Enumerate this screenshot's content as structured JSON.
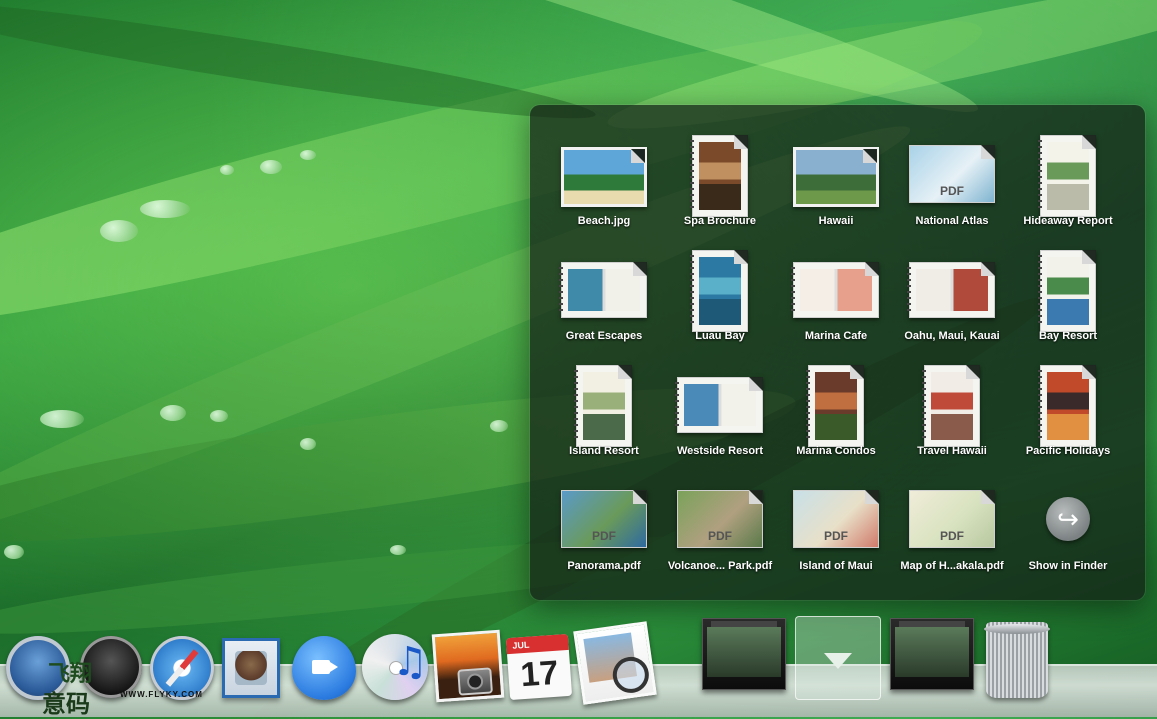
{
  "stack": {
    "items": [
      {
        "label": "Beach.jpg",
        "kind": "photo",
        "colors": [
          "#5ea6d8",
          "#2d7a3a",
          "#e8dcae"
        ]
      },
      {
        "label": "Spa Brochure",
        "kind": "brochure",
        "colors": [
          "#7a4a2a",
          "#c09060",
          "#3a2a1a"
        ]
      },
      {
        "label": "Hawaii",
        "kind": "photo",
        "colors": [
          "#8ab0d0",
          "#3d6e3a",
          "#6d9a4a"
        ]
      },
      {
        "label": "National Atlas",
        "kind": "pdf",
        "pdf_text": "PDF",
        "colors": [
          "#a9d2e8",
          "#e6f1f6",
          "#7fb4d0"
        ]
      },
      {
        "label": "Hideaway Report",
        "kind": "brochure",
        "colors": [
          "#f3f3ea",
          "#6a9a5a",
          "#bbbbaa"
        ]
      },
      {
        "label": "Great Escapes",
        "kind": "spread",
        "colors": [
          "#3f8aa8",
          "#f1f1ea",
          "#5aa05a"
        ]
      },
      {
        "label": "Luau Bay",
        "kind": "brochure",
        "colors": [
          "#2c7aa4",
          "#5ab0c8",
          "#1e5a78"
        ]
      },
      {
        "label": "Marina Cafe",
        "kind": "spread",
        "colors": [
          "#f4eee6",
          "#e7a08c",
          "#c04a3a"
        ]
      },
      {
        "label": "Oahu, Maui, Kauai",
        "kind": "spread",
        "colors": [
          "#f0ede6",
          "#b04a3a",
          "#6a8a5a"
        ]
      },
      {
        "label": "Bay Resort",
        "kind": "brochure",
        "colors": [
          "#f2f2ea",
          "#4a8a4a",
          "#3a7ab0"
        ]
      },
      {
        "label": "Island Resort",
        "kind": "brochure",
        "colors": [
          "#f2f0e2",
          "#9ab07a",
          "#4a6a4a"
        ]
      },
      {
        "label": "Westside Resort",
        "kind": "spread",
        "colors": [
          "#4a8ab8",
          "#f2f2ea",
          "#3a6a3a"
        ]
      },
      {
        "label": "Marina Condos",
        "kind": "brochure",
        "colors": [
          "#6a3a2a",
          "#c07040",
          "#3a5a2a"
        ]
      },
      {
        "label": "Travel Hawaii",
        "kind": "brochure",
        "colors": [
          "#f2ece6",
          "#c04a3a",
          "#8a5a4a"
        ]
      },
      {
        "label": "Pacific Holidays",
        "kind": "brochure",
        "colors": [
          "#c04a2a",
          "#3a2a2a",
          "#e09040"
        ]
      },
      {
        "label": "Panorama.pdf",
        "kind": "pdf",
        "pdf_text": "PDF",
        "colors": [
          "#5a9ac8",
          "#6a9a5a",
          "#2e6aa0"
        ]
      },
      {
        "label": "Volcanoe... Park.pdf",
        "kind": "pdf",
        "pdf_text": "PDF",
        "colors": [
          "#7aa25a",
          "#b0a080",
          "#5a7a4a"
        ]
      },
      {
        "label": "Island of Maui",
        "kind": "pdf",
        "pdf_text": "PDF",
        "colors": [
          "#c8e0e8",
          "#e8e0c8",
          "#d07a6a"
        ]
      },
      {
        "label": "Map of H...akala.pdf",
        "kind": "pdf",
        "pdf_text": "PDF",
        "colors": [
          "#f0ecd8",
          "#d8e2c0",
          "#b8c8a0"
        ]
      },
      {
        "label": "Show in Finder",
        "kind": "finder",
        "icon": "arrow-icon",
        "colors": [
          "#999999",
          "#777777",
          "#bbbbbb"
        ]
      }
    ]
  },
  "dock": {
    "items": [
      {
        "name": "finder",
        "icon": "finder-icon"
      },
      {
        "name": "dashboard",
        "icon": "dashboard-icon"
      },
      {
        "name": "safari",
        "icon": "safari-icon"
      },
      {
        "name": "mail",
        "icon": "mail-icon"
      },
      {
        "name": "ichat",
        "icon": "ichat-icon"
      },
      {
        "name": "itunes",
        "icon": "itunes-icon"
      },
      {
        "name": "iphoto",
        "icon": "iphoto-icon"
      },
      {
        "name": "ical",
        "icon": "ical-icon",
        "month": "JUL",
        "day": "17"
      },
      {
        "name": "preview",
        "icon": "preview-icon"
      },
      {
        "name": "stack-folder-1",
        "icon": "stack-folder-icon"
      },
      {
        "name": "stack-folder-open",
        "icon": "stack-open-arrow-icon"
      },
      {
        "name": "stack-folder-2",
        "icon": "stack-folder-icon"
      },
      {
        "name": "trash",
        "icon": "trash-icon"
      }
    ]
  },
  "watermark": {
    "line1": "飞翔",
    "line2": "意码",
    "url": "WWW.FLYKY.COM"
  }
}
